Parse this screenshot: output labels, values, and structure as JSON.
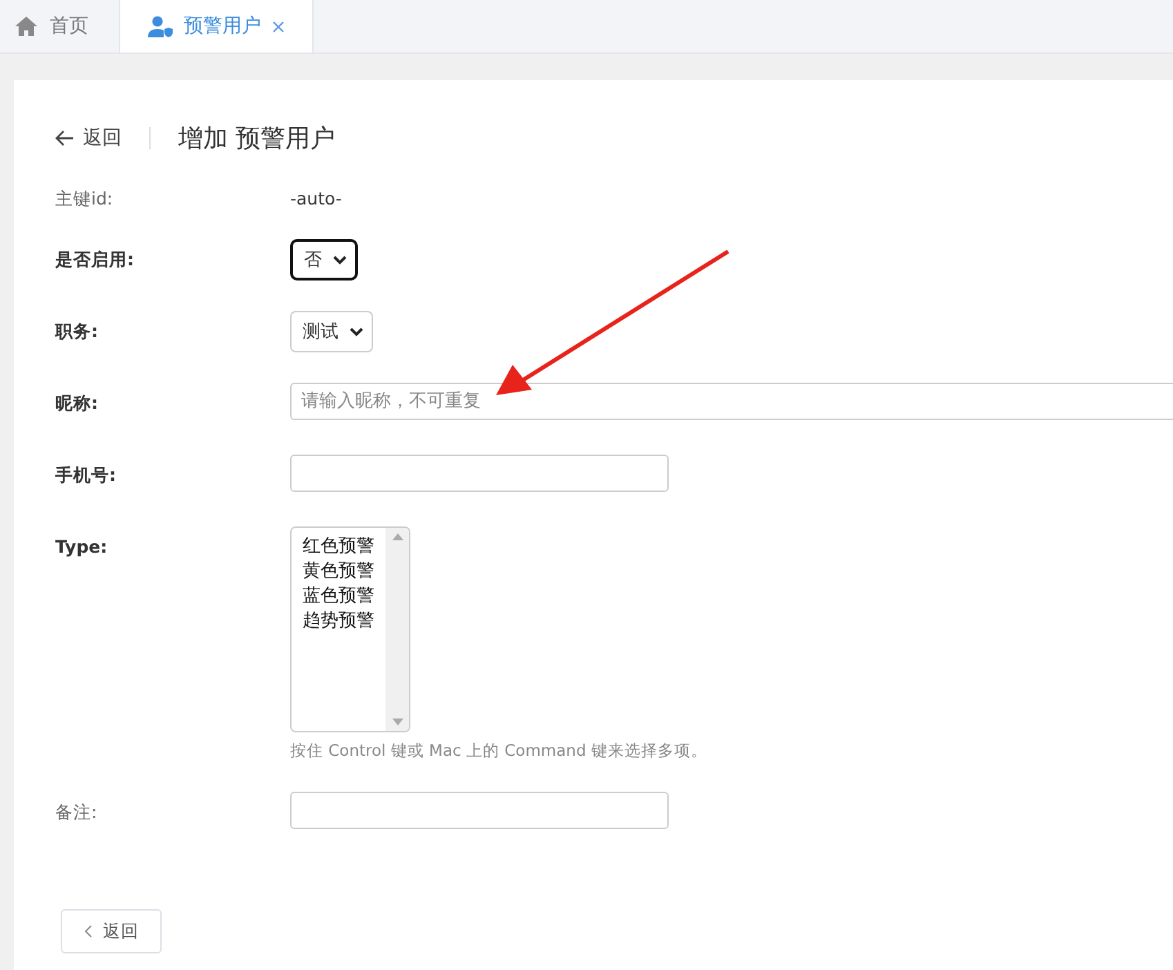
{
  "tabs": [
    {
      "label": "首页",
      "kind": "home",
      "selected": false,
      "closable": false
    },
    {
      "label": "预警用户",
      "kind": "user",
      "selected": true,
      "closable": true
    }
  ],
  "header": {
    "back_link": "返回",
    "title": "增加 预警用户"
  },
  "fields": [
    {
      "label": "主键id:",
      "required": false,
      "kind": "text",
      "value": "-auto-"
    },
    {
      "label": "是否启用:",
      "required": true,
      "kind": "select",
      "value": "否",
      "focused": true
    },
    {
      "label": "职务:",
      "required": true,
      "kind": "select",
      "value": "测试",
      "focused": false
    },
    {
      "label": "昵称:",
      "required": true,
      "kind": "input",
      "wide": true,
      "placeholder": "请输入昵称，不可重复"
    },
    {
      "label": "手机号:",
      "required": true,
      "kind": "input",
      "wide": false
    },
    {
      "label": "Type:",
      "required": true,
      "kind": "listbox",
      "options": [
        "红色预警",
        "黄色预警",
        "蓝色预警",
        "趋势预警"
      ],
      "help": "按住 Control 键或 Mac 上的 Command 键来选择多项。"
    },
    {
      "label": "备注:",
      "required": false,
      "kind": "input",
      "wide": false
    }
  ],
  "back_button": "返回"
}
